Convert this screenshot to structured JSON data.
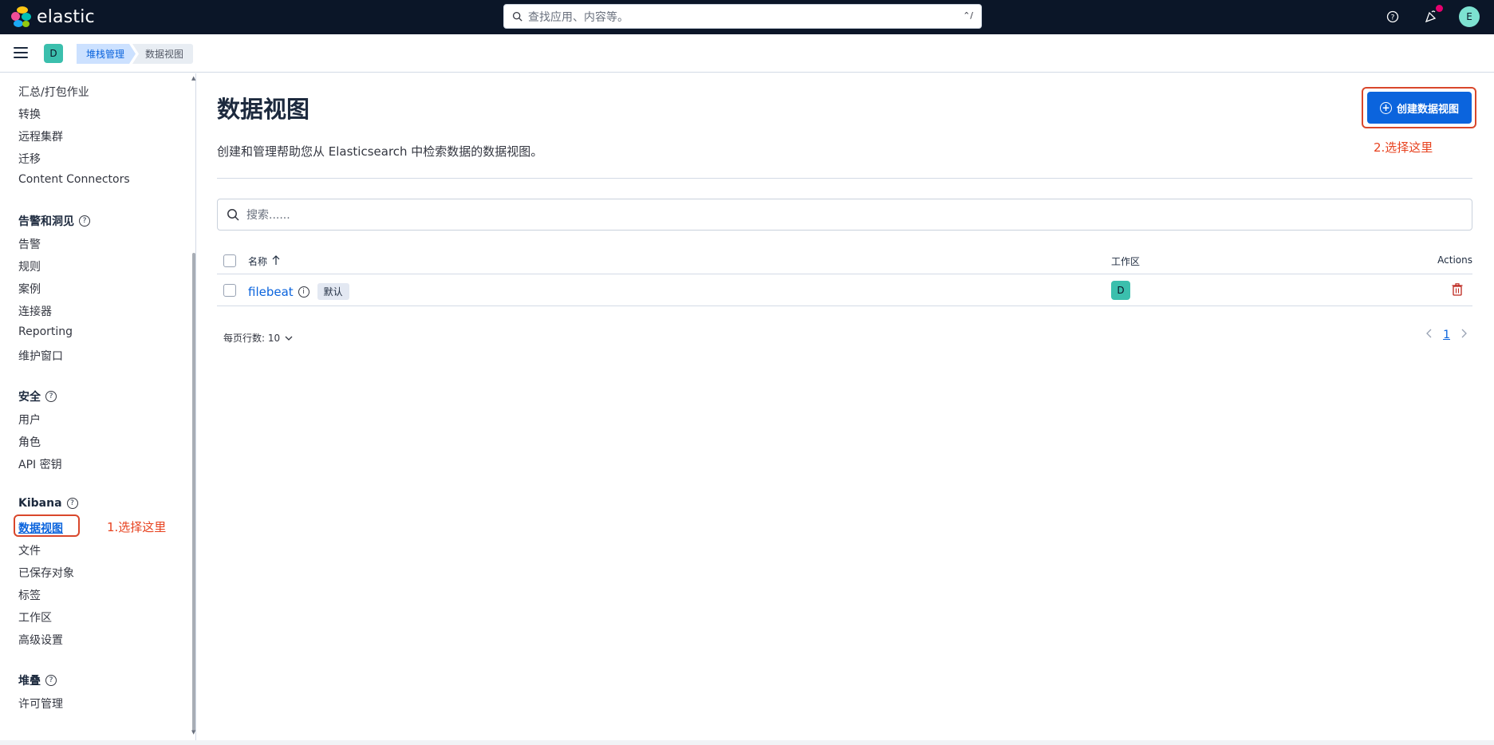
{
  "header": {
    "logo_text": "elastic",
    "search_placeholder": "查找应用、内容等。",
    "search_shortcut": "⌃/",
    "icons": [
      "help-icon",
      "newsfeed-icon",
      "user-avatar"
    ],
    "user_initial": "E"
  },
  "subbar": {
    "space_initial": "D",
    "breadcrumbs": [
      "堆栈管理",
      "数据视图"
    ]
  },
  "sidebar": {
    "group0_items": [
      "汇总/打包作业",
      "转换",
      "远程集群",
      "迁移",
      "Content Connectors"
    ],
    "group1": {
      "title": "告警和洞见",
      "items": [
        "告警",
        "规则",
        "案例",
        "连接器",
        "Reporting",
        "维护窗口"
      ]
    },
    "group2": {
      "title": "安全",
      "items": [
        "用户",
        "角色",
        "API 密钥"
      ]
    },
    "group3": {
      "title": "Kibana",
      "items": [
        "数据视图",
        "文件",
        "已保存对象",
        "标签",
        "工作区",
        "高级设置"
      ]
    },
    "group4": {
      "title": "堆叠",
      "items": [
        "许可管理"
      ]
    },
    "annotation": "1.选择这里"
  },
  "main": {
    "title": "数据视图",
    "description": "创建和管理帮助您从 Elasticsearch 中检索数据的数据视图。",
    "create_button": "创建数据视图",
    "annotation": "2.选择这里",
    "search_placeholder": "搜索......",
    "table": {
      "columns": [
        "名称",
        "工作区",
        "Actions"
      ],
      "rows": [
        {
          "name": "filebeat",
          "badge": "默认",
          "space": "D"
        }
      ]
    },
    "rows_per_page": "每页行数: 10",
    "current_page": "1"
  },
  "colors": {
    "header_bg": "#0b1628",
    "primary": "#0b64dd",
    "annotation": "#e7421f",
    "space_badge": "#3bbfad",
    "danger": "#bd271e"
  }
}
